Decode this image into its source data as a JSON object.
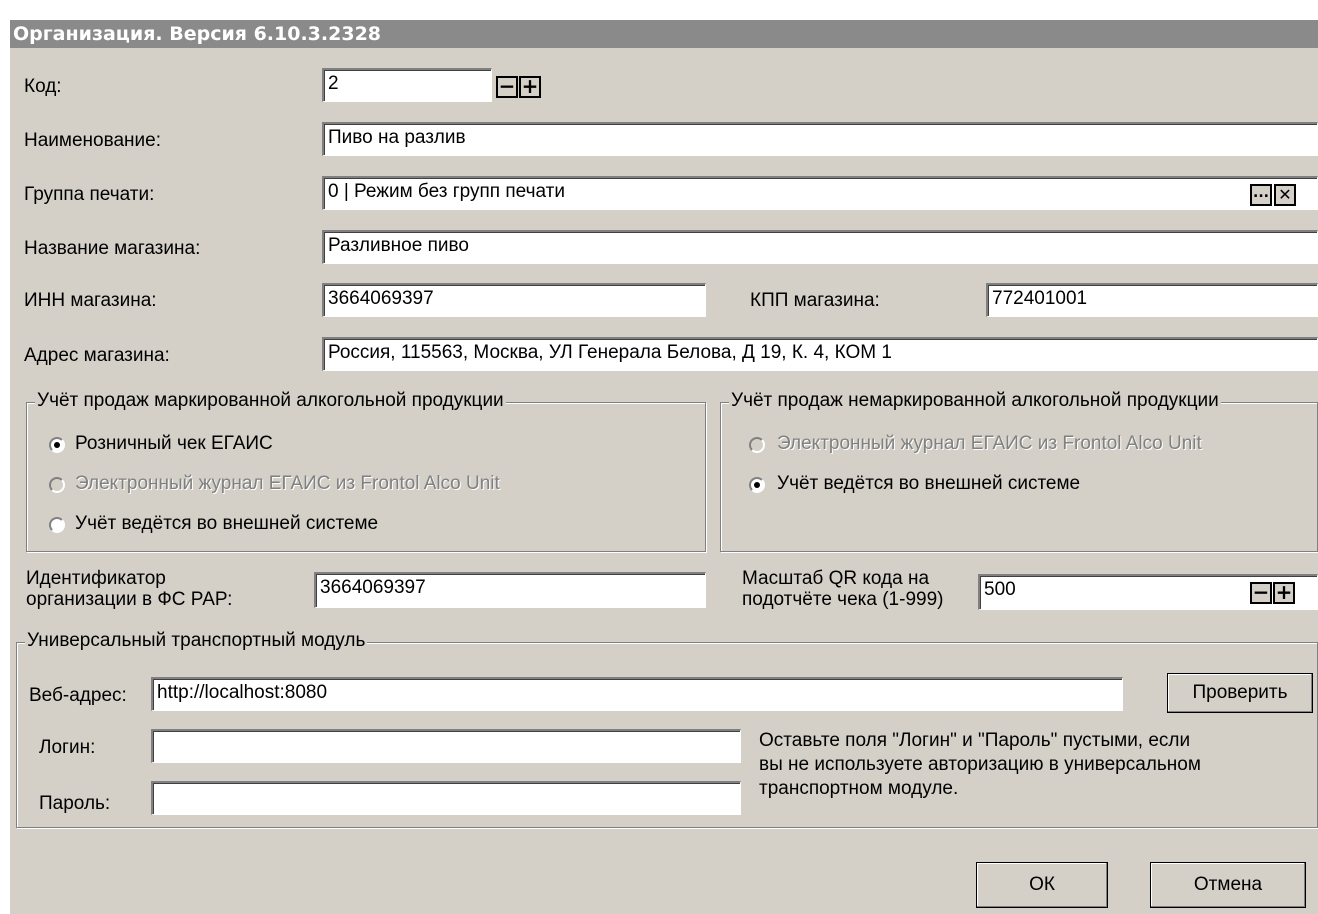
{
  "window": {
    "title": "Организация. Версия 6.10.3.2328"
  },
  "fields": {
    "code_label": "Код:",
    "code_value": "2",
    "name_label": "Наименование:",
    "name_value": "Пиво на разлив",
    "print_group_label": "Группа печати:",
    "print_group_value": "0 | Режим без групп печати",
    "print_group_browse": "...",
    "print_group_clear": "✕",
    "shop_name_label": "Название магазина:",
    "shop_name_value": "Разливное пиво",
    "inn_label": "ИНН магазина:",
    "inn_value": "3664069397",
    "kpp_label": "КПП магазина:",
    "kpp_value": "772401001",
    "address_label": "Адрес магазина:",
    "address_value": "Россия, 115563, Москва, УЛ Генерала Белова, Д 19, К. 4, КОМ 1",
    "minus": "−",
    "plus": "+"
  },
  "marked_group": {
    "legend": "Учёт продаж маркированной алкогольной продукции",
    "options": [
      {
        "label": "Розничный чек ЕГАИС",
        "checked": true,
        "disabled": false
      },
      {
        "label": "Электронный журнал ЕГАИС из Frontol Alco Unit",
        "checked": false,
        "disabled": true
      },
      {
        "label": "Учёт ведётся во внешней системе",
        "checked": false,
        "disabled": false
      }
    ]
  },
  "unmarked_group": {
    "legend": "Учёт продаж немаркированной алкогольной продукции",
    "options": [
      {
        "label": "Электронный журнал ЕГАИС из Frontol Alco Unit",
        "checked": false,
        "disabled": true
      },
      {
        "label": "Учёт ведётся во внешней системе",
        "checked": true,
        "disabled": false
      }
    ]
  },
  "fsrar": {
    "label_line1": "Идентификатор",
    "label_line2": "организации в ФС РАР:",
    "value": "3664069397"
  },
  "qr_scale": {
    "label_line1": "Масштаб QR кода на",
    "label_line2": "подотчёте чека (1-999)",
    "value": "500"
  },
  "utm": {
    "legend": "Универсальный транспортный модуль",
    "url_label": "Веб-адрес:",
    "url_value": "http://localhost:8080",
    "check_button": "Проверить",
    "login_label": "Логин:",
    "login_value": "",
    "password_label": "Пароль:",
    "password_value": "",
    "hint_line1": "Оставьте поля \"Логин\" и \"Пароль\" пустыми, если",
    "hint_line2": "вы не используете авторизацию в универсальном",
    "hint_line3": "транспортном модуле."
  },
  "buttons": {
    "ok": "ОК",
    "cancel": "Отмена"
  }
}
